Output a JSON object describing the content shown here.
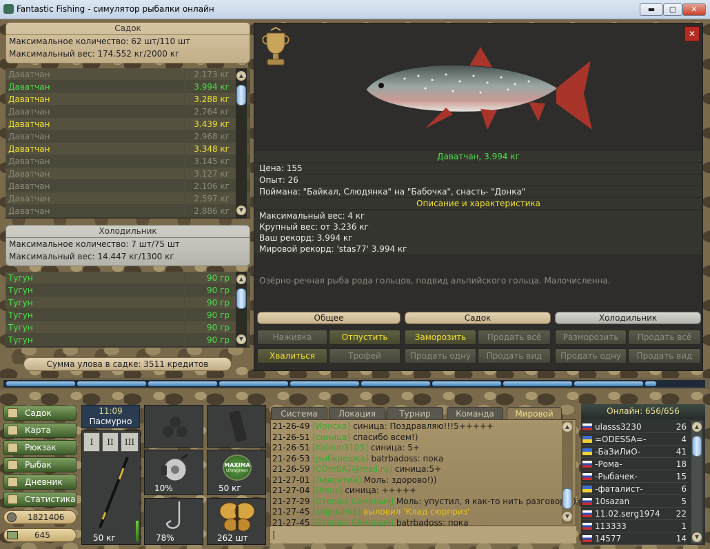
{
  "window": {
    "title": "Fantastic Fishing - симулятор рыбалки онлайн",
    "btn_min": "▬",
    "btn_max": "▢",
    "btn_close": "✕"
  },
  "sadok": {
    "title": "Садок",
    "max_count": "Максимальное количество: 62 шт/110 шт",
    "max_weight": "Максимальный вес: 174.552 кг/2000 кг",
    "rows": [
      {
        "name": "Даватчан",
        "weight": "2.173 кг",
        "color": "#8c8a78"
      },
      {
        "name": "Даватчан",
        "weight": "3.994 кг",
        "color": "#4ce04a"
      },
      {
        "name": "Даватчан",
        "weight": "3.288 кг",
        "color": "#f0e030"
      },
      {
        "name": "Даватчан",
        "weight": "2.764 кг",
        "color": "#8c8a78"
      },
      {
        "name": "Даватчан",
        "weight": "3.439 кг",
        "color": "#f0e030"
      },
      {
        "name": "Даватчан",
        "weight": "2.968 кг",
        "color": "#8c8a78"
      },
      {
        "name": "Даватчан",
        "weight": "3.348 кг",
        "color": "#f0e030"
      },
      {
        "name": "Даватчан",
        "weight": "3.145 кг",
        "color": "#8c8a78"
      },
      {
        "name": "Даватчан",
        "weight": "3.127 кг",
        "color": "#8c8a78"
      },
      {
        "name": "Даватчан",
        "weight": "2.106 кг",
        "color": "#8c8a78"
      },
      {
        "name": "Даватчан",
        "weight": "2.597 кг",
        "color": "#8c8a78"
      },
      {
        "name": "Даватчан",
        "weight": "2.886 кг",
        "color": "#8c8a78"
      }
    ]
  },
  "fridge": {
    "title": "Холодильник",
    "max_count": "Максимальное количество: 7 шт/75 шт",
    "max_weight": "Максимальный вес: 14.447 кг/1300 кг",
    "rows": [
      {
        "name": "Тугун",
        "weight": "90 гр"
      },
      {
        "name": "Тугун",
        "weight": "90 гр"
      },
      {
        "name": "Тугун",
        "weight": "90 гр"
      },
      {
        "name": "Тугун",
        "weight": "90 гр"
      },
      {
        "name": "Тугун",
        "weight": "90 гр"
      },
      {
        "name": "Тугун",
        "weight": "90 гр"
      }
    ]
  },
  "summary": "Сумма улова в садке: 3511 кредитов",
  "fish": {
    "caption": "Даватчан, 3.994 кг",
    "price": "Цена: 155",
    "exp": "Опыт: 26",
    "caught": "Поймана: \"Байкал, Слюдянка\" на \"Бабочка\", снасть- \"Донка\"",
    "desc_header": "Описание и характеристика",
    "max_w": "Максимальный вес: 4 кг",
    "big_w": "Крупный вес: от 3.236 кг",
    "your_rec": "Ваш рекорд: 3.994 кг",
    "world_rec": "Мировой рекорд: 'stas77' 3.994 кг",
    "desc": "Озёрно-речная рыба рода гольцов, подвид альпийского гольца. Малочисленна."
  },
  "detail_tabs": {
    "general": "Общее",
    "sadok": "Садок",
    "fridge": "Холодильник"
  },
  "detail_buttons": {
    "bait": "Наживка",
    "release": "Отпустить",
    "brag": "Хвалиться",
    "trophy": "Трофей",
    "freeze": "Заморозить",
    "sell_all": "Продать всё",
    "sell_one": "Продать одну",
    "sell_kind": "Продать вид",
    "unfreeze": "Разморозить",
    "f_sell_all": "Продать всё",
    "f_sell_one": "Продать одну",
    "f_sell_kind": "Продать вид"
  },
  "progress": {
    "filled_fraction": 0.93
  },
  "nav": {
    "items": [
      "Садок",
      "Карта",
      "Рюкзак",
      "Рыбак",
      "Дневник",
      "Статистика"
    ],
    "money": "1821406",
    "gold": "645"
  },
  "weather": {
    "time": "11:09",
    "cond": "Пасмурно"
  },
  "rod_slots": [
    "I",
    "II",
    "III"
  ],
  "gear": {
    "rod_weight": "50 кг",
    "reel": "10%",
    "line": "50 кг",
    "hook": "78%",
    "bait": "262 шт",
    "line_brand": "MAXIMA",
    "line_sub": "Ultragreen"
  },
  "chat": {
    "tabs": [
      "Система",
      "Локация",
      "Турнир",
      "Команда",
      "Мировой"
    ],
    "lines": [
      {
        "time": "21-26-49",
        "nick": "[Ириска]",
        "msg": "синица: Поздравляю!!!5+++++",
        "hl": false
      },
      {
        "time": "21-26-51",
        "nick": "[синица]",
        "msg": "спасибо всем!)",
        "hl": false
      },
      {
        "time": "21-26-51",
        "nick": "[Koldun3105]",
        "msg": "синица: 5+",
        "hl": false
      },
      {
        "time": "21-26-53",
        "nick": "[рыбкаешка]",
        "msg": "batrbadoss: пока",
        "hl": false
      },
      {
        "time": "21-26-59",
        "nick": "[COmBAT@mail.ru]",
        "msg": "синица:5+",
        "hl": false
      },
      {
        "time": "21-27-01",
        "nick": "[Левонтий]",
        "msg": "Моль: здорово!))",
        "hl": false
      },
      {
        "time": "21-27-04",
        "nick": "[Ursus]",
        "msg": "синица: +++++",
        "hl": false
      },
      {
        "time": "21-27-29",
        "nick": "[Степан_Семеныч]",
        "msg": "Моль: упустил, я как-то нить разговора ))",
        "hl": false
      },
      {
        "time": "21-27-45",
        "nick": "[shipuchka]",
        "msg": "выловил 'Клад сюрприз'",
        "hl": true
      },
      {
        "time": "21-27-45",
        "nick": "[Степан_Семеныч]",
        "msg": "batrbadoss: пока",
        "hl": false
      }
    ],
    "input_prompt": "|"
  },
  "online": {
    "title": "Онлайн: 656/656",
    "users": [
      {
        "name": "ulasss3230",
        "lvl": "26",
        "flag": "ru"
      },
      {
        "name": "=ODESSA=-",
        "lvl": "4",
        "flag": "ua"
      },
      {
        "name": "-БаЗиЛиО-",
        "lvl": "41",
        "flag": "ua"
      },
      {
        "name": "-Рома-",
        "lvl": "18",
        "flag": "ru"
      },
      {
        "name": "-Рыбачек-",
        "lvl": "15",
        "flag": "ru"
      },
      {
        "name": "-фаталист-",
        "lvl": "6",
        "flag": "ua"
      },
      {
        "name": "10sazan",
        "lvl": "5",
        "flag": "ru"
      },
      {
        "name": "11.02.serg1974",
        "lvl": "22",
        "flag": "ru"
      },
      {
        "name": "113333",
        "lvl": "1",
        "flag": "ru"
      },
      {
        "name": "14577",
        "lvl": "14",
        "flag": "ru"
      }
    ]
  },
  "colors": {
    "green": "#4ce04a",
    "yellow": "#f0e030",
    "grey": "#8c8a78"
  }
}
